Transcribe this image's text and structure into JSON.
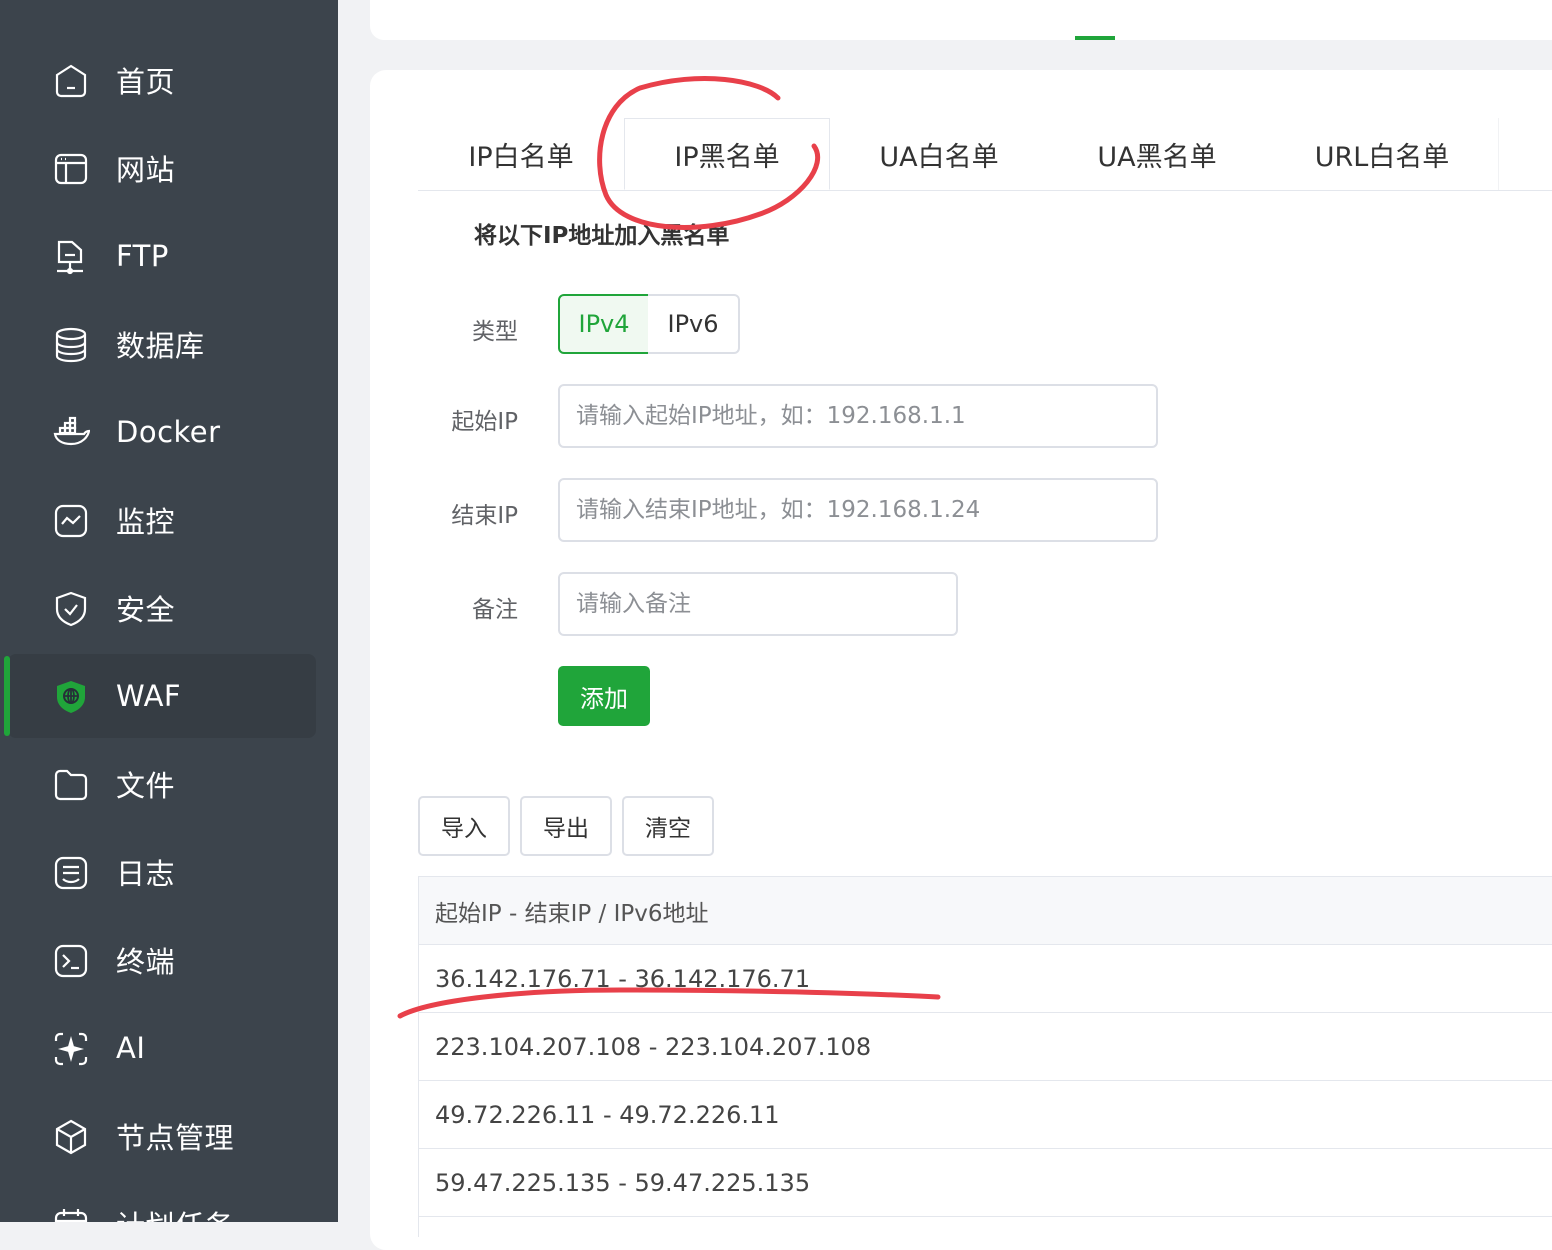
{
  "sidebar": {
    "items": [
      {
        "label": "首页",
        "icon": "home-icon"
      },
      {
        "label": "网站",
        "icon": "website-icon"
      },
      {
        "label": "FTP",
        "icon": "ftp-icon"
      },
      {
        "label": "数据库",
        "icon": "database-icon"
      },
      {
        "label": "Docker",
        "icon": "docker-icon"
      },
      {
        "label": "监控",
        "icon": "monitor-icon"
      },
      {
        "label": "安全",
        "icon": "shield-check-icon"
      },
      {
        "label": "WAF",
        "icon": "waf-shield-icon",
        "active": true
      },
      {
        "label": "文件",
        "icon": "folder-icon"
      },
      {
        "label": "日志",
        "icon": "log-icon"
      },
      {
        "label": "终端",
        "icon": "terminal-icon"
      },
      {
        "label": "AI",
        "icon": "ai-sparkle-icon"
      },
      {
        "label": "节点管理",
        "icon": "cube-icon"
      },
      {
        "label": "计划任务",
        "icon": "calendar-icon"
      }
    ]
  },
  "tabs": [
    {
      "label": "IP白名单"
    },
    {
      "label": "IP黑名单",
      "active": true
    },
    {
      "label": "UA白名单"
    },
    {
      "label": "UA黑名单"
    },
    {
      "label": "URL白名单"
    }
  ],
  "form": {
    "title": "将以下IP地址加入黑名单",
    "type_label": "类型",
    "type_options": [
      "IPv4",
      "IPv6"
    ],
    "type_selected": "IPv4",
    "start_ip_label": "起始IP",
    "start_ip_placeholder": "请输入起始IP地址，如：192.168.1.1",
    "end_ip_label": "结束IP",
    "end_ip_placeholder": "请输入结束IP地址，如：192.168.1.24",
    "note_label": "备注",
    "note_placeholder": "请输入备注",
    "add_button": "添加"
  },
  "toolbar": {
    "import_label": "导入",
    "export_label": "导出",
    "clear_label": "清空"
  },
  "table": {
    "header": "起始IP - 结束IP / IPv6地址",
    "rows": [
      "36.142.176.71 - 36.142.176.71",
      "223.104.207.108 - 223.104.207.108",
      "49.72.226.11 - 49.72.226.11",
      "59.47.225.135 - 59.47.225.135"
    ]
  },
  "colors": {
    "accent": "#20a53a",
    "sidebar_bg": "#3c444c",
    "annotation": "#e8404a"
  }
}
